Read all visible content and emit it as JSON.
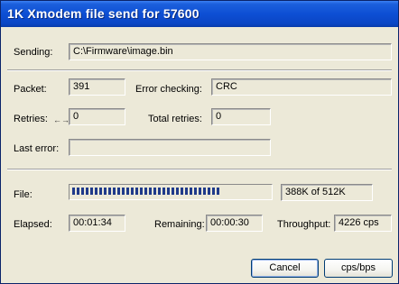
{
  "window": {
    "title": "1K Xmodem file send for 57600"
  },
  "sending": {
    "label": "Sending:",
    "value": "C:\\Firmware\\image.bin"
  },
  "packet": {
    "label": "Packet:",
    "value": "391"
  },
  "error_checking": {
    "label": "Error checking:",
    "value": "CRC"
  },
  "retries": {
    "label": "Retries:",
    "value": "0",
    "icon": "resize-arrows-icon"
  },
  "total_retries": {
    "label": "Total retries:",
    "value": "0"
  },
  "last_error": {
    "label": "Last error:",
    "value": ""
  },
  "file": {
    "label": "File:",
    "progress_fraction": 0.758,
    "progress_text": "388K of 512K"
  },
  "elapsed": {
    "label": "Elapsed:",
    "value": "00:01:34"
  },
  "remaining": {
    "label": "Remaining:",
    "value": "00:00:30"
  },
  "throughput": {
    "label": "Throughput:",
    "value": "4226 cps"
  },
  "buttons": {
    "cancel": "Cancel",
    "cps_bps": "cps/bps"
  },
  "colors": {
    "title_bar": "#0a45c4",
    "dialog_bg": "#ece9d8",
    "progress_fill": "#1f3a8a"
  }
}
